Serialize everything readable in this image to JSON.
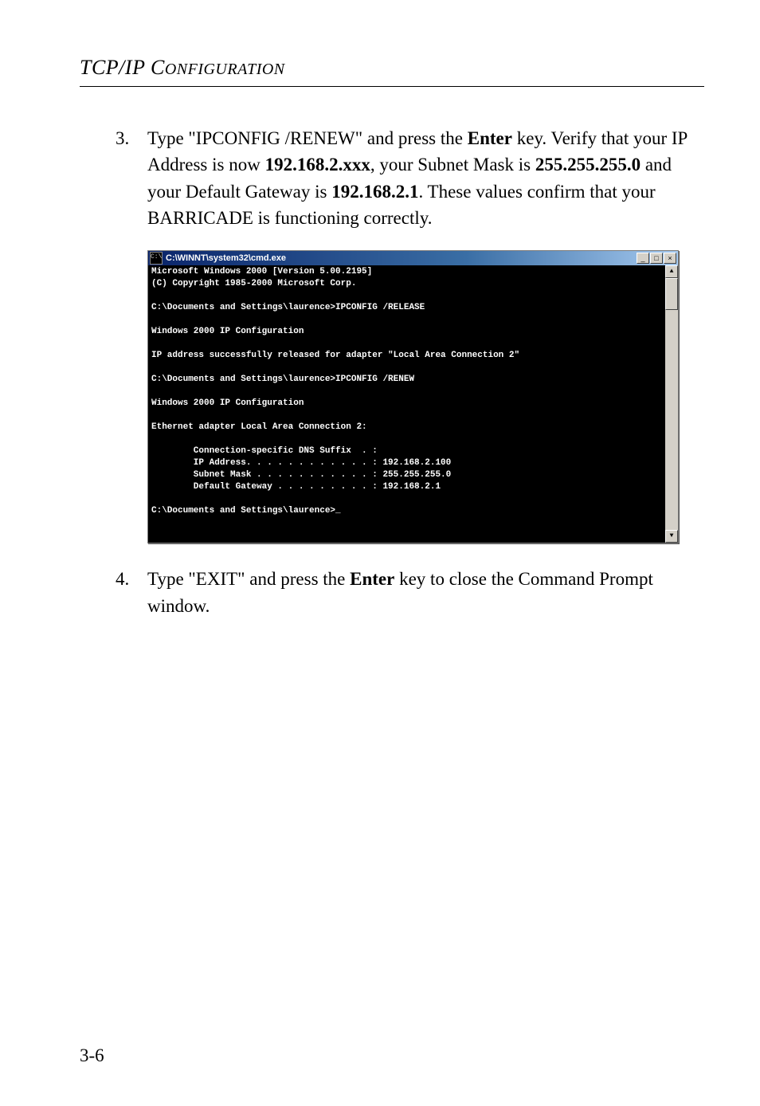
{
  "header": "TCP/IP CONFIGURATION",
  "steps": {
    "s3": {
      "num": "3.",
      "t1": "Type \"IPCONFIG /RENEW\" and press the ",
      "b1": "Enter",
      "t2": " key. Verify that your IP Address is now ",
      "b2": "192.168.2.xxx",
      "t3": ", your Subnet Mask is ",
      "b3": "255.255.255.0",
      "t4": " and your Default Gateway is ",
      "b4": "192.168.2.1",
      "t5": ". These values confirm that your BARRICADE is functioning correctly."
    },
    "s4": {
      "num": "4.",
      "t1": "Type \"EXIT\" and press the ",
      "b1": "Enter",
      "t2": " key to close the Command Prompt window."
    }
  },
  "cmd": {
    "title": "C:\\WINNT\\system32\\cmd.exe",
    "icon_label": "C:\\",
    "lines": "Microsoft Windows 2000 [Version 5.00.2195]\n(C) Copyright 1985-2000 Microsoft Corp.\n\nC:\\Documents and Settings\\laurence>IPCONFIG /RELEASE\n\nWindows 2000 IP Configuration\n\nIP address successfully released for adapter \"Local Area Connection 2\"\n\nC:\\Documents and Settings\\laurence>IPCONFIG /RENEW\n\nWindows 2000 IP Configuration\n\nEthernet adapter Local Area Connection 2:\n\n        Connection-specific DNS Suffix  . :\n        IP Address. . . . . . . . . . . . : 192.168.2.100\n        Subnet Mask . . . . . . . . . . . : 255.255.255.0\n        Default Gateway . . . . . . . . . : 192.168.2.1\n\nC:\\Documents and Settings\\laurence>_\n\n\n"
  },
  "win_btns": {
    "min": "_",
    "max": "□",
    "close": "×",
    "up": "▲",
    "down": "▼"
  },
  "page_number": "3-6"
}
